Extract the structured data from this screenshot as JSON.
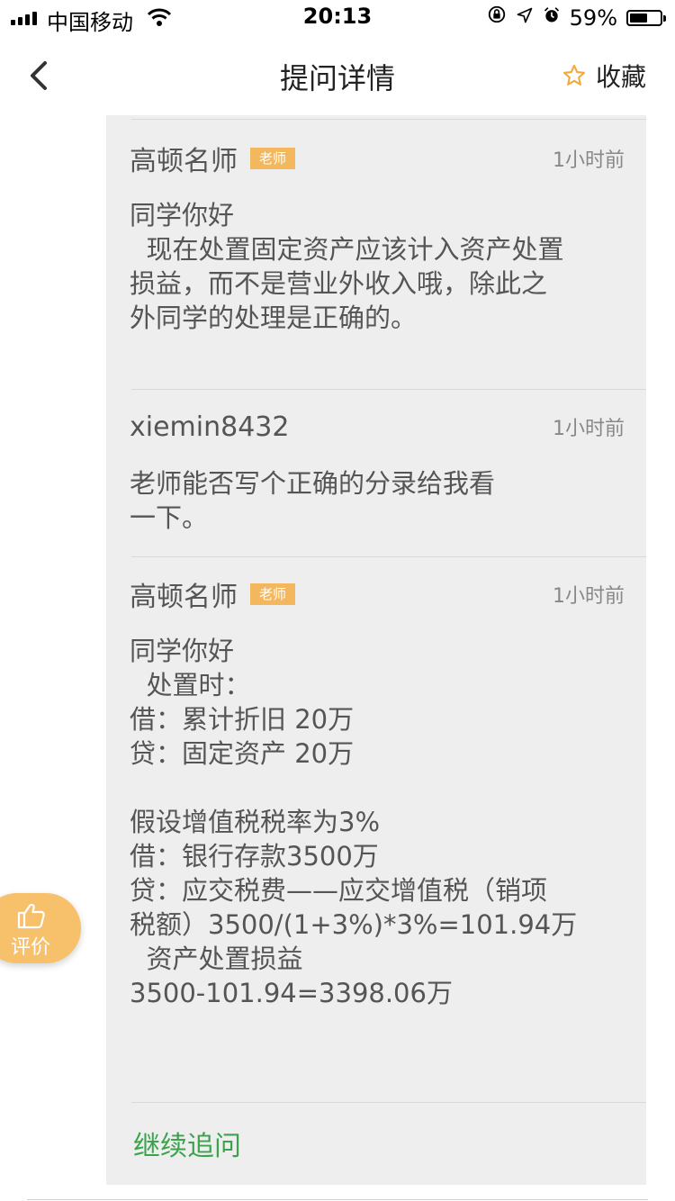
{
  "status_bar": {
    "carrier": "中国移动",
    "time": "20:13",
    "battery_percent": "59%",
    "battery_level": 0.59,
    "icons": [
      "signal-icon",
      "wifi-icon",
      "orientation-lock-icon",
      "location-icon",
      "alarm-icon",
      "battery-icon"
    ]
  },
  "nav": {
    "title": "提问详情",
    "favorite_label": "收藏",
    "back_icon": "chevron-left-icon",
    "favorite_icon": "star-outline-icon"
  },
  "messages": [
    {
      "author": "高顿名师",
      "badge": "老师",
      "time": "1小时前",
      "body": "同学你好\n  现在处置固定资产应该计入资产处置\n损益，而不是营业外收入哦，除此之\n外同学的处理是正确的。"
    },
    {
      "author": "xiemin8432",
      "time": "1小时前",
      "body": "老师能否写个正确的分录给我看\n一下。"
    },
    {
      "author": "高顿名师",
      "badge": "老师",
      "time": "1小时前",
      "body": "同学你好\n  处置时：\n借：累计折旧 20万\n贷：固定资产 20万\n\n假设增值税税率为3%\n借：银行存款3500万\n贷：应交税费——应交增值税（销项\n税额）3500/(1+3%)*3%=101.94万\n  资产处置损益\n3500-101.94=3398.06万"
    }
  ],
  "follow_up_label": "继续追问",
  "rate_button": {
    "label": "评价",
    "icon": "thumbs-up-icon"
  },
  "colors": {
    "accent_green": "#3aa34c",
    "badge_orange": "#f3b75e",
    "rate_button": "#f7c06a",
    "panel_bg": "#eeeeee"
  }
}
